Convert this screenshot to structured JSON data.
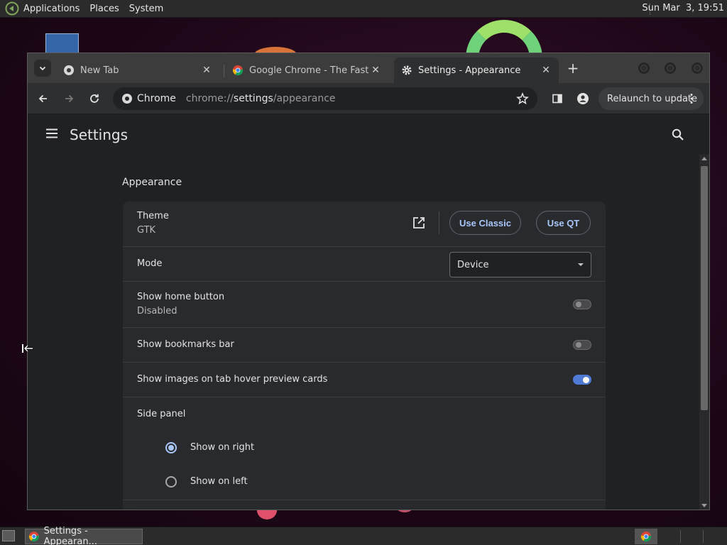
{
  "top_panel": {
    "menus": [
      "Applications",
      "Places",
      "System"
    ],
    "clock": "Sun Mar  3, 19:51"
  },
  "tabs": [
    {
      "title": "New Tab",
      "icon": "chrome-icon",
      "active": false
    },
    {
      "title": "Google Chrome - The Fast & Se",
      "icon": "chrome-icon",
      "active": false
    },
    {
      "title": "Settings - Appearance",
      "icon": "gear-icon",
      "active": true
    }
  ],
  "toolbar": {
    "chip_label": "Chrome",
    "url_scheme": "chrome://",
    "url_host": "settings",
    "url_path": "/appearance",
    "relaunch_label": "Relaunch to update"
  },
  "settings": {
    "page_title": "Settings",
    "section_title": "Appearance",
    "theme": {
      "label": "Theme",
      "value": "GTK",
      "use_classic": "Use Classic",
      "use_qt": "Use QT"
    },
    "mode": {
      "label": "Mode",
      "selected": "Device"
    },
    "home_button": {
      "label": "Show home button",
      "sub": "Disabled",
      "enabled": false
    },
    "bookmarks_bar": {
      "label": "Show bookmarks bar",
      "enabled": false
    },
    "hover_cards": {
      "label": "Show images on tab hover preview cards",
      "enabled": true
    },
    "side_panel": {
      "label": "Side panel",
      "options": [
        "Show on right",
        "Show on left"
      ],
      "selected": "Show on right"
    }
  },
  "taskbar": {
    "window_label": "Settings - Appearan..."
  },
  "colors": {
    "accent": "#a8c7fa",
    "toggle_on": "#4f7ad6",
    "page_bg": "#202124",
    "card_bg": "#292a2d"
  }
}
